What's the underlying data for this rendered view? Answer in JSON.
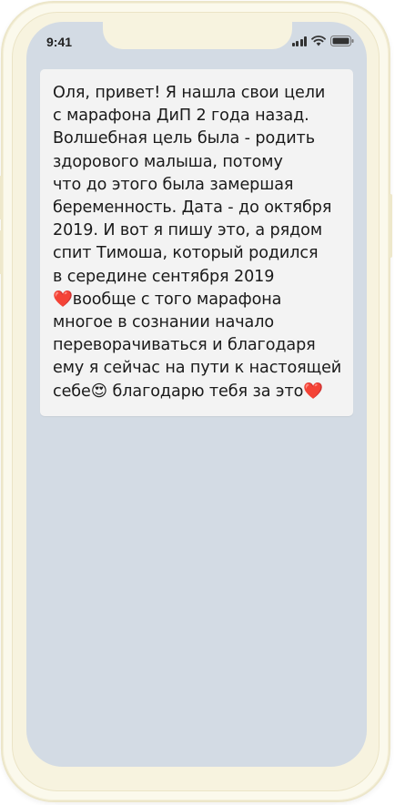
{
  "status_bar": {
    "time": "9:41",
    "icons": [
      "cellular-signal-icon",
      "wifi-icon",
      "battery-icon"
    ]
  },
  "message": {
    "text": "Оля, привет! Я нашла свои цели\nс марафона ДиП 2 года назад.\nВолшебная цель была - родить\nздорового малыша, потому\nчто до этого была замершая\nбеременность. Дата - до октября\n2019. И вот я пишу это, а рядом\nспит Тимоша, который родился\nв середине сентября 2019\n❤️вообще с того марафона\nмногое в сознании начало\nпереворачиваться и благодаря\nему я сейчас на пути к настоящей\nсебе😍 благодарю тебя за это❤️"
  },
  "colors": {
    "screen_background": "#d3dbe4",
    "bubble_background": "#f3f3f3",
    "phone_frame": "#fbf9ec"
  }
}
